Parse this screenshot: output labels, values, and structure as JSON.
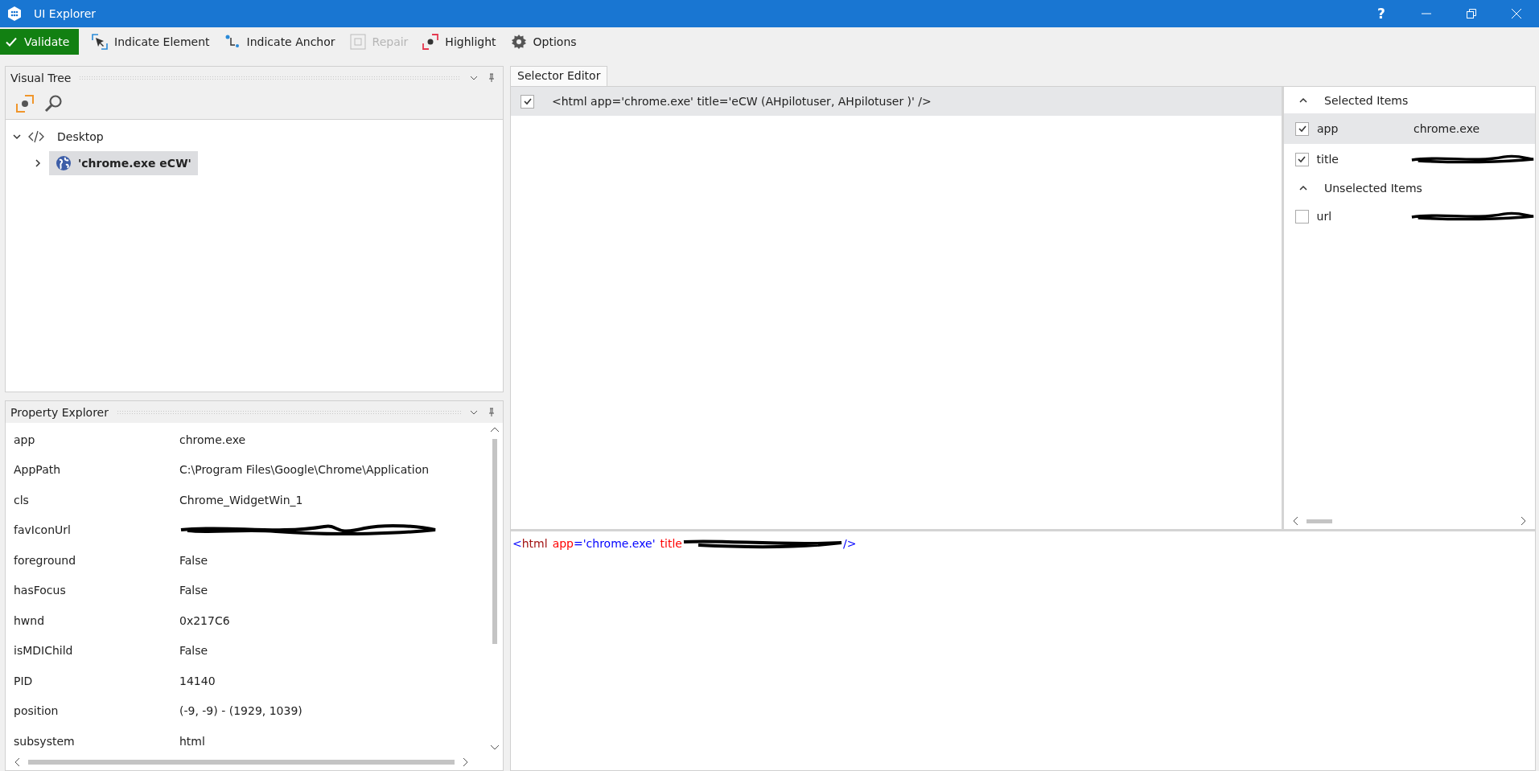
{
  "window": {
    "title": "UI Explorer",
    "controls": [
      "?"
    ]
  },
  "toolbar": [
    {
      "kind": "validate",
      "label": "Validate",
      "disabled": false
    },
    {
      "kind": "element",
      "label": "Indicate Element",
      "disabled": false
    },
    {
      "kind": "anchor",
      "label": "Indicate Anchor",
      "disabled": false
    },
    {
      "kind": "repair",
      "label": "Repair",
      "disabled": true
    },
    {
      "kind": "highlight",
      "label": "Highlight",
      "disabled": false
    },
    {
      "kind": "options",
      "label": "Options",
      "disabled": false
    }
  ],
  "visual_tree": {
    "title": "Visual Tree",
    "nodes": [
      {
        "label": "Desktop",
        "kind": "code",
        "expanded": true,
        "selected": false,
        "children": [
          {
            "label": "'chrome.exe eCW'",
            "kind": "globe",
            "expanded": false,
            "selected": true
          }
        ]
      }
    ]
  },
  "property_explorer": {
    "title": "Property Explorer",
    "rows": [
      {
        "name": "app",
        "value": "chrome.exe"
      },
      {
        "name": "AppPath",
        "value": "C:\\Program Files\\Google\\Chrome\\Application"
      },
      {
        "name": "cls",
        "value": "Chrome_WidgetWin_1"
      },
      {
        "name": "favIconUrl",
        "redacted": true
      },
      {
        "name": "foreground",
        "value": "False"
      },
      {
        "name": "hasFocus",
        "value": "False"
      },
      {
        "name": "hwnd",
        "value": "0x217C6"
      },
      {
        "name": "isMDIChild",
        "value": "False"
      },
      {
        "name": "PID",
        "value": "14140"
      },
      {
        "name": "position",
        "value": "(-9, -9) - (1929, 1039)"
      },
      {
        "name": "subsystem",
        "value": "html"
      }
    ]
  },
  "selector_editor": {
    "tab": {
      "label": "Selector Editor",
      "selected": true
    },
    "rows": [
      {
        "checked": true,
        "text": "<html app='chrome.exe' title='eCW (AHpilotuser, AHpilotuser )' />"
      }
    ],
    "groups": [
      {
        "title": "Selected Items",
        "expanded": true,
        "items": [
          {
            "name": "app",
            "value": "chrome.exe",
            "checked": true,
            "selected": true
          },
          {
            "name": "title",
            "redacted": true,
            "checked": true,
            "selected": false
          }
        ]
      },
      {
        "title": "Unselected Items",
        "expanded": true,
        "items": [
          {
            "name": "url",
            "redacted": true,
            "checked": false,
            "selected": false
          }
        ]
      }
    ],
    "xml": [
      {
        "kind": "punct",
        "text": "<"
      },
      {
        "kind": "tag",
        "text": "html"
      },
      {
        "kind": "attr",
        "text": "app"
      },
      {
        "kind": "punct",
        "text": "="
      },
      {
        "kind": "value",
        "text": "'chrome.exe'"
      },
      {
        "kind": "attr",
        "text": "title"
      },
      {
        "kind": "redacted"
      },
      {
        "kind": "punct",
        "text": "/>"
      }
    ]
  }
}
